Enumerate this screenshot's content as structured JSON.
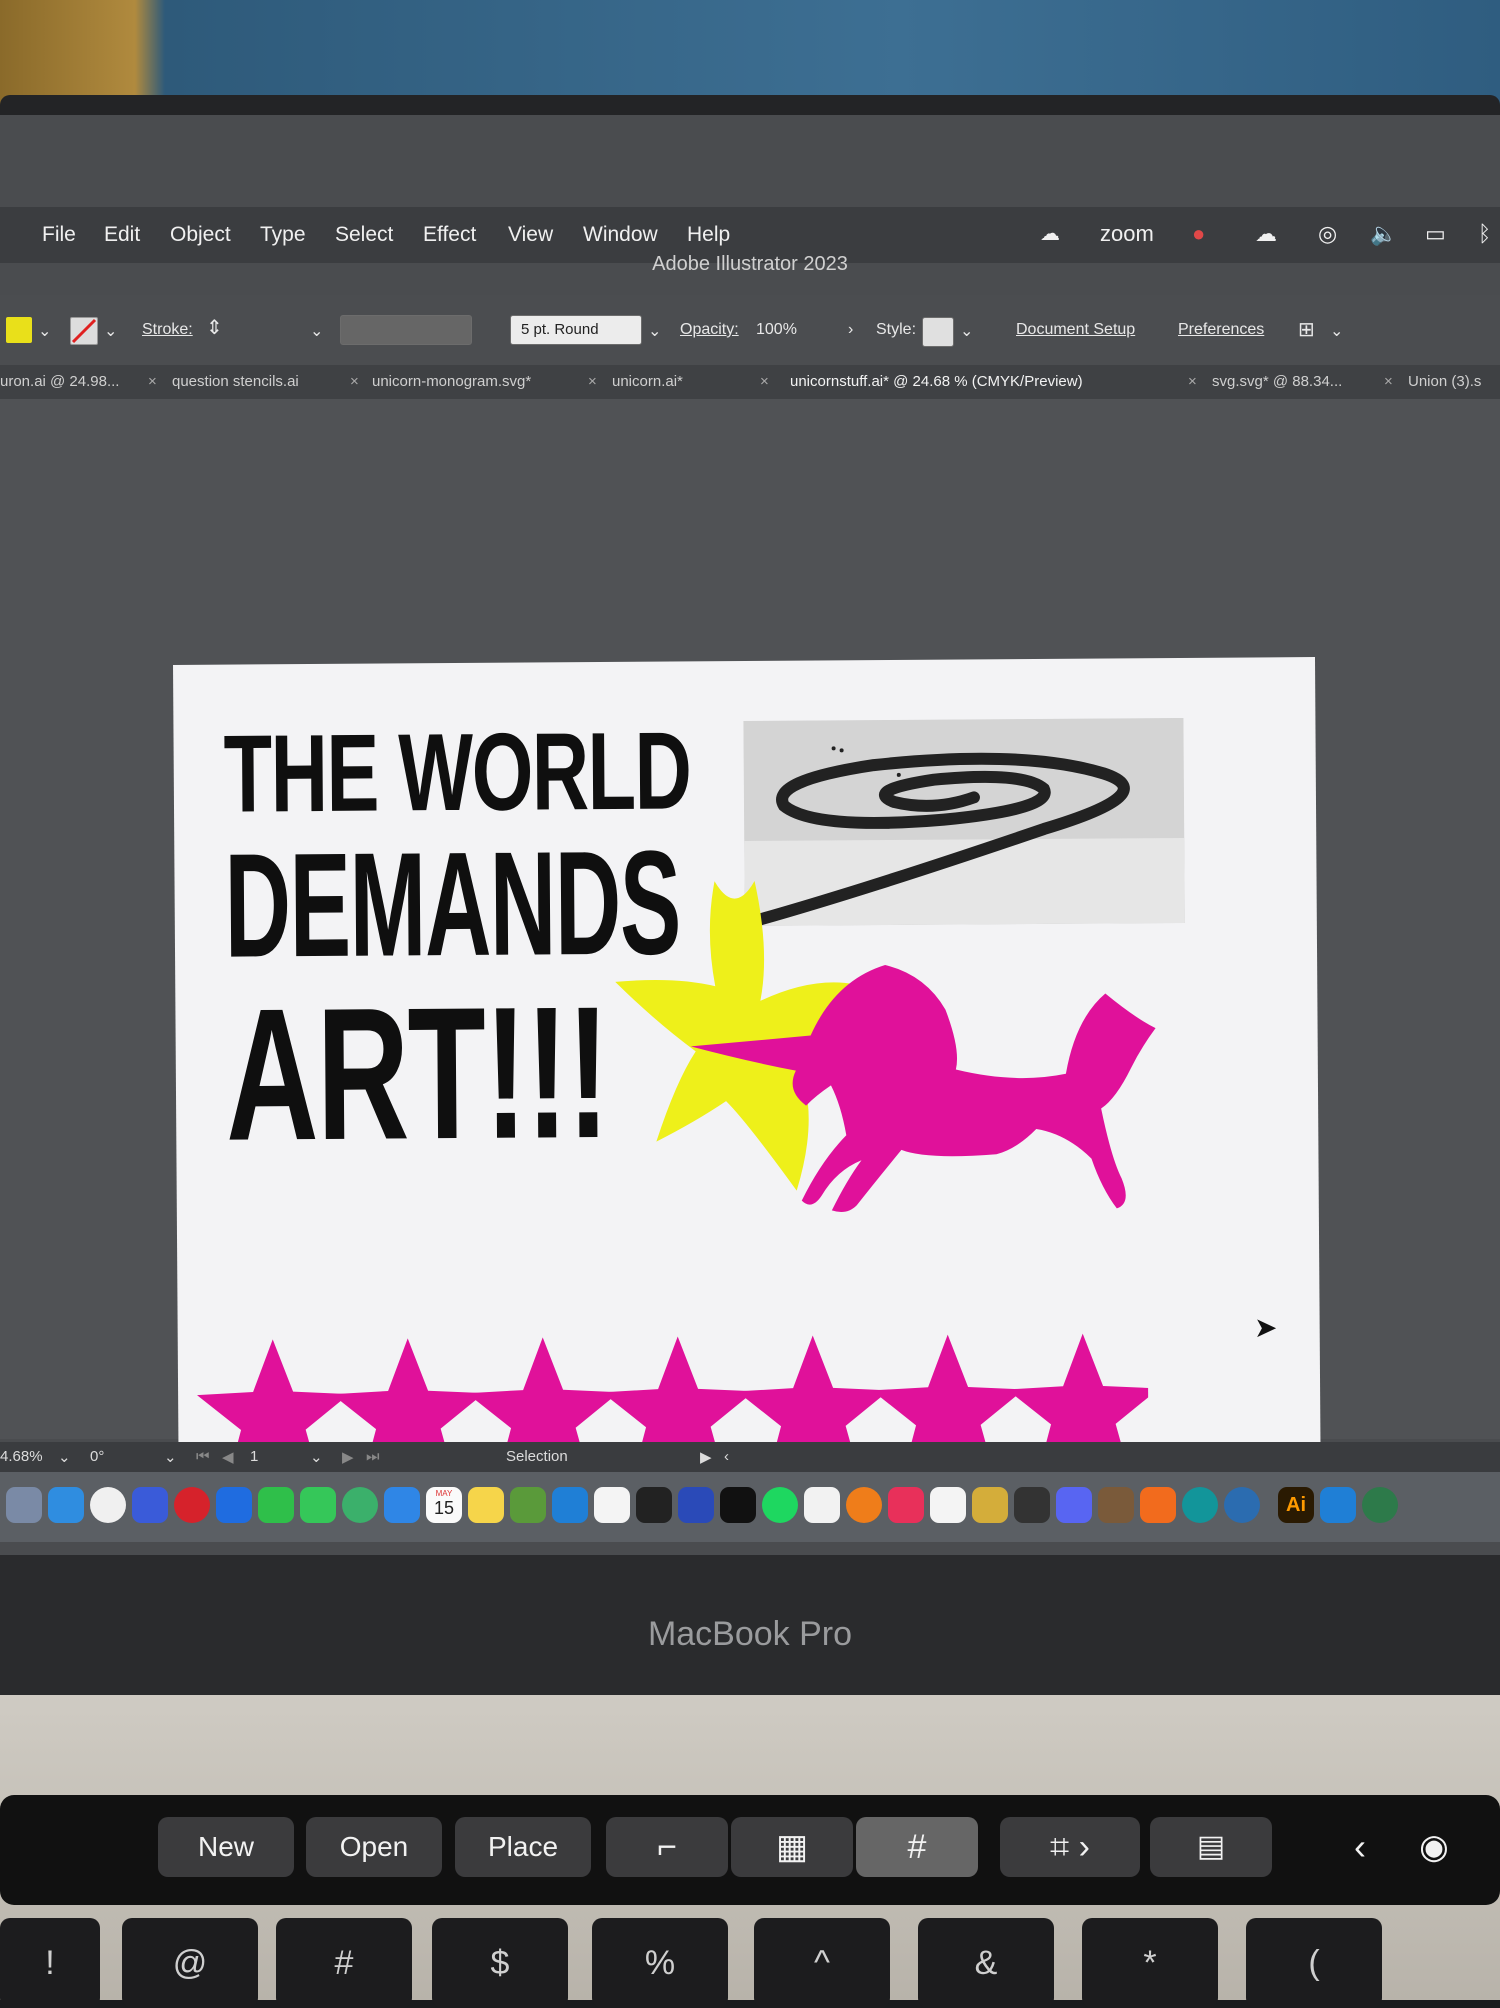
{
  "menubar": {
    "items": [
      "File",
      "Edit",
      "Object",
      "Type",
      "Select",
      "Effect",
      "View",
      "Window",
      "Help"
    ],
    "zoom_label": "zoom",
    "window_title": "Adobe Illustrator 2023"
  },
  "control_bar": {
    "stroke_label": "Stroke:",
    "brush_label": "5 pt. Round",
    "opacity_label": "Opacity:",
    "opacity_value": "100%",
    "style_label": "Style:",
    "doc_setup_label": "Document Setup",
    "preferences_label": "Preferences",
    "fill_color": "#e9e01a"
  },
  "tabs": [
    {
      "label": "uron.ai @ 24.98..."
    },
    {
      "label": "question stencils.ai"
    },
    {
      "label": "unicorn-monogram.svg*"
    },
    {
      "label": "unicorn.ai*"
    },
    {
      "label": "unicornstuff.ai* @ 24.68 % (CMYK/Preview)"
    },
    {
      "label": "svg.svg* @ 88.34..."
    },
    {
      "label": "Union (3).s"
    }
  ],
  "artboard": {
    "headline_line1": "THE WORLD",
    "headline_line2": "DEMANDS",
    "headline_line3": "ART!!!",
    "star_count": 7,
    "accent_magenta": "#e0119a",
    "accent_yellow": "#eef01a"
  },
  "statusbar": {
    "zoom": "4.68%",
    "rotation": "0°",
    "artboard_number": "1",
    "tool": "Selection"
  },
  "dock": {
    "calendar_month": "MAY",
    "calendar_day": "15",
    "ai_label": "Ai"
  },
  "bezel": {
    "brand": "MacBook Pro"
  },
  "touchbar": {
    "new_label": "New",
    "open_label": "Open",
    "place_label": "Place"
  },
  "keys": [
    "!",
    "@",
    "#",
    "$",
    "%",
    "^",
    "&",
    "*",
    "("
  ]
}
